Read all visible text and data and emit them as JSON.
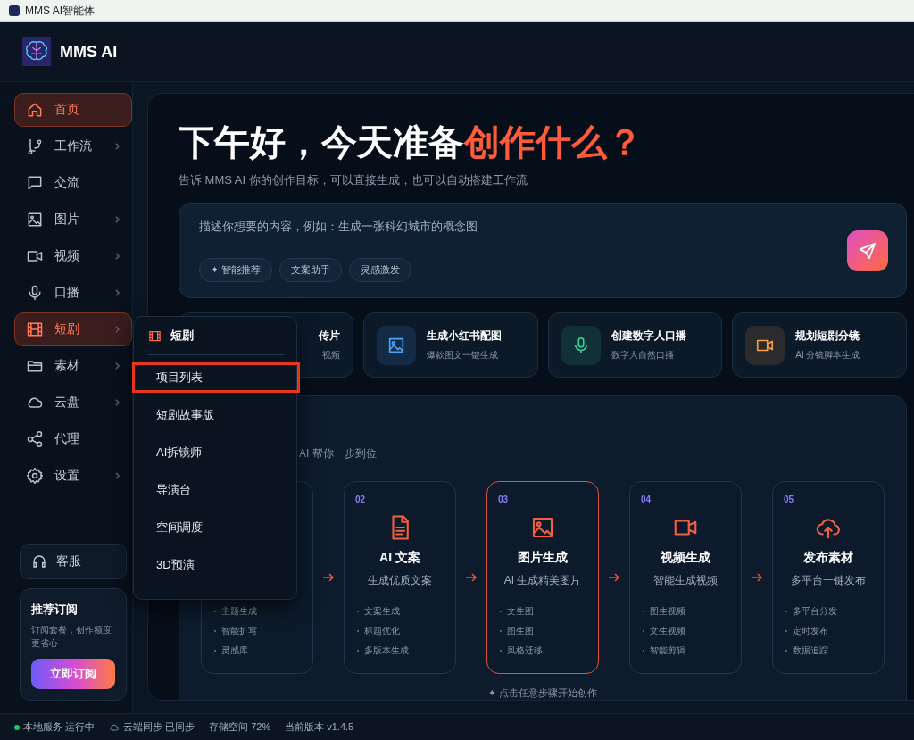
{
  "window": {
    "title": "MMS AI智能体"
  },
  "brand": {
    "name": "MMS AI"
  },
  "sidebar": {
    "items": [
      {
        "label": "首页",
        "selected": true,
        "submenu": false
      },
      {
        "label": "工作流",
        "selected": false,
        "submenu": true
      },
      {
        "label": "交流",
        "selected": false,
        "submenu": false
      },
      {
        "label": "图片",
        "selected": false,
        "submenu": true
      },
      {
        "label": "视频",
        "selected": false,
        "submenu": true
      },
      {
        "label": "口播",
        "selected": false,
        "submenu": true
      },
      {
        "label": "短剧",
        "selected": true,
        "submenu": true
      },
      {
        "label": "素材",
        "selected": false,
        "submenu": true
      },
      {
        "label": "云盘",
        "selected": false,
        "submenu": true
      },
      {
        "label": "代理",
        "selected": false,
        "submenu": false
      },
      {
        "label": "设置",
        "selected": false,
        "submenu": true
      }
    ],
    "support": "客服",
    "promo": {
      "title": "推荐订阅",
      "text": "订阅套餐，创作额度更省心",
      "button": "立即订阅"
    }
  },
  "flyout": {
    "title": "短剧",
    "items": [
      {
        "label": "项目列表",
        "selected": true
      },
      {
        "label": "短剧故事版",
        "selected": false
      },
      {
        "label": "AI拆镜师",
        "selected": false
      },
      {
        "label": "导演台",
        "selected": false
      },
      {
        "label": "空间调度",
        "selected": false
      },
      {
        "label": "3D预演",
        "selected": false
      }
    ]
  },
  "hero": {
    "greeting": "下午好，今天准备",
    "highlight": "创作什么？",
    "subtitle": "告诉 MMS AI 你的创作目标，可以直接生成，也可以自动搭建工作流"
  },
  "prompt": {
    "placeholder": "描述你想要的内容，例如：生成一张科幻城市的概念图",
    "chips": [
      "✦ 智能推荐",
      "文案助手",
      "灵感激发"
    ]
  },
  "quick_actions": [
    {
      "title": "传片",
      "subtitle": "视频"
    },
    {
      "title": "生成小红书配图",
      "subtitle": "爆款图文一键生成",
      "color": "#4aa3ff"
    },
    {
      "title": "创建数字人口播",
      "subtitle": "数字人自然口播",
      "color": "#34d399"
    },
    {
      "title": "规划短剧分镜",
      "subtitle": "AI 分镜脚本生成",
      "color": "#f5a142"
    }
  ],
  "workflow": {
    "subtitle": "AI 帮你一步到位",
    "steps": [
      {
        "bullets": [
          "主题生成",
          "智能扩写",
          "灵感库"
        ],
        "selected": false
      },
      {
        "number": "02",
        "title": "AI 文案",
        "subtitle": "生成优质文案",
        "bullets": [
          "文案生成",
          "标题优化",
          "多版本生成"
        ],
        "selected": false
      },
      {
        "number": "03",
        "title": "图片生成",
        "subtitle": "AI 生成精美图片",
        "bullets": [
          "文生图",
          "图生图",
          "风格迁移"
        ],
        "selected": true
      },
      {
        "number": "04",
        "title": "视频生成",
        "subtitle": "智能生成视频",
        "bullets": [
          "图生视频",
          "文生视频",
          "智能剪辑"
        ],
        "selected": false
      },
      {
        "number": "05",
        "title": "发布素材",
        "subtitle": "多平台一键发布",
        "bullets": [
          "多平台分发",
          "定时发布",
          "数据追踪"
        ],
        "selected": false
      }
    ],
    "hint": "✦ 点击任意步骤开始创作"
  },
  "status_bar": [
    {
      "kind": "dot",
      "text": "本地服务 运行中",
      "color": "#22c55e"
    },
    {
      "kind": "cloud",
      "text": "云端同步 已同步"
    },
    {
      "kind": "plain",
      "text": "存储空间 72%"
    },
    {
      "kind": "plain",
      "text": "当前版本 v1.4.5"
    }
  ]
}
